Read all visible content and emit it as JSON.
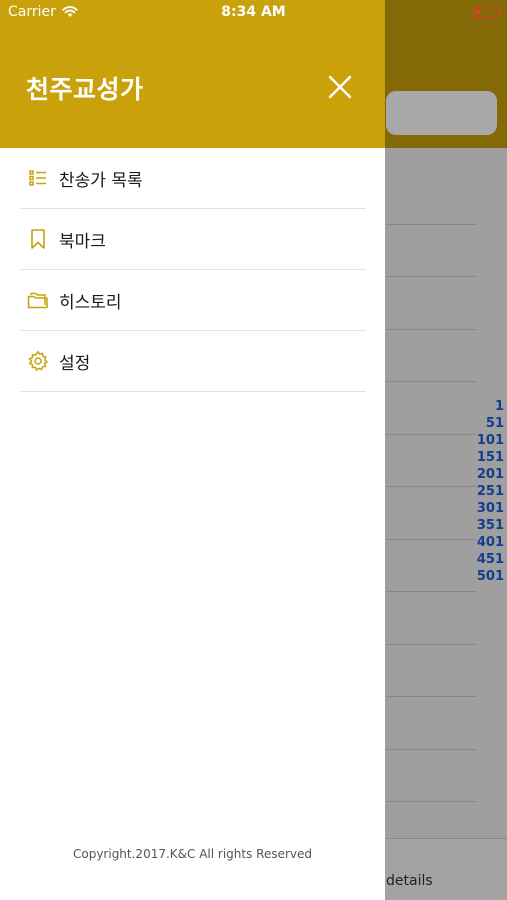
{
  "status_bar": {
    "carrier": "Carrier",
    "time": "8:34 AM"
  },
  "drawer": {
    "title": "천주교성가",
    "menu": [
      {
        "label": "찬송가 목록",
        "icon": "list-icon"
      },
      {
        "label": "북마크",
        "icon": "bookmark-icon"
      },
      {
        "label": "히스토리",
        "icon": "folder-icon"
      },
      {
        "label": "설정",
        "icon": "gear-icon"
      }
    ],
    "copyright": "Copyright.2017.K&C All rights Reserved"
  },
  "background": {
    "index": [
      "1",
      "51",
      "101",
      "151",
      "201",
      "251",
      "301",
      "351",
      "401",
      "451",
      "501"
    ],
    "bottom_text": "details"
  },
  "colors": {
    "accent": "#c9a10a",
    "index_blue": "#1a5fd6",
    "battery": "#e63a2e"
  }
}
